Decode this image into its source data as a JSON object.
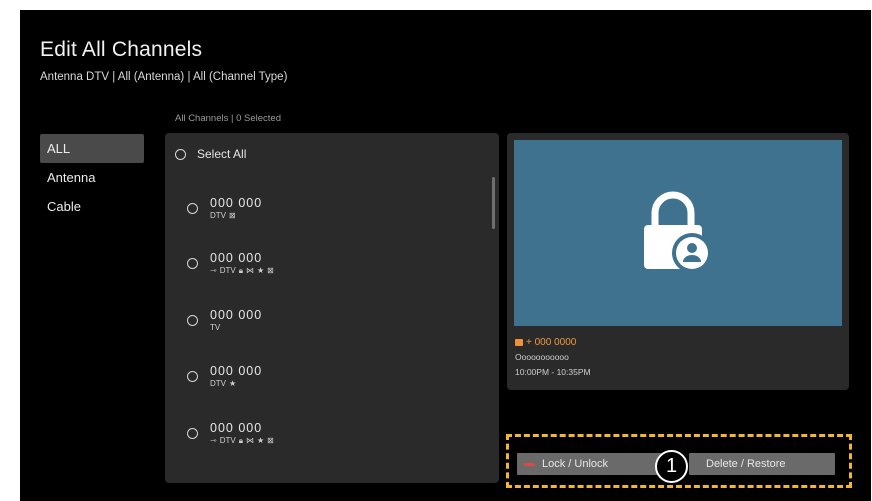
{
  "header": {
    "title": "Edit All Channels",
    "subtitle": "Antenna DTV | All (Antenna) | All (Channel Type)"
  },
  "sidebar": {
    "items": [
      {
        "label": "ALL",
        "active": true
      },
      {
        "label": "Antenna",
        "active": false
      },
      {
        "label": "Cable",
        "active": false
      }
    ]
  },
  "channel_list": {
    "count_label": "All Channels | 0 Selected",
    "select_all_label": "Select All",
    "rows": [
      {
        "number": "000 000",
        "type": "DTV",
        "icons": [
          "no-signal-icon"
        ]
      },
      {
        "number": "000 000",
        "type": "DTV",
        "prefix_icon": "arrow-right-icon",
        "icons": [
          "lock-icon",
          "skip-icon",
          "favorite-star-icon",
          "no-signal-icon"
        ]
      },
      {
        "number": "000 000",
        "type": "TV",
        "icons": []
      },
      {
        "number": "000 000",
        "type": "DTV",
        "icons": [
          "favorite-star-icon"
        ]
      },
      {
        "number": "000 000",
        "type": "DTV",
        "prefix_icon": "arrow-right-icon",
        "icons": [
          "lock-icon",
          "skip-icon",
          "favorite-star-icon",
          "no-signal-icon"
        ]
      }
    ]
  },
  "preview": {
    "icon": "locked-user-icon",
    "channel_line": "+ 000 0000",
    "program_name": "Ooooooooooo",
    "time_range": "10:00PM - 10:35PM"
  },
  "actions": {
    "lock_label": "Lock / Unlock",
    "delete_label": "Delete / Restore",
    "callout_number": "1"
  },
  "colors": {
    "background": "#000000",
    "panel": "#2a2a2a",
    "preview": "#3f728f",
    "accent_orange": "#f09a3e",
    "highlight_yellow": "#f2b632",
    "red_key": "#e04848"
  }
}
